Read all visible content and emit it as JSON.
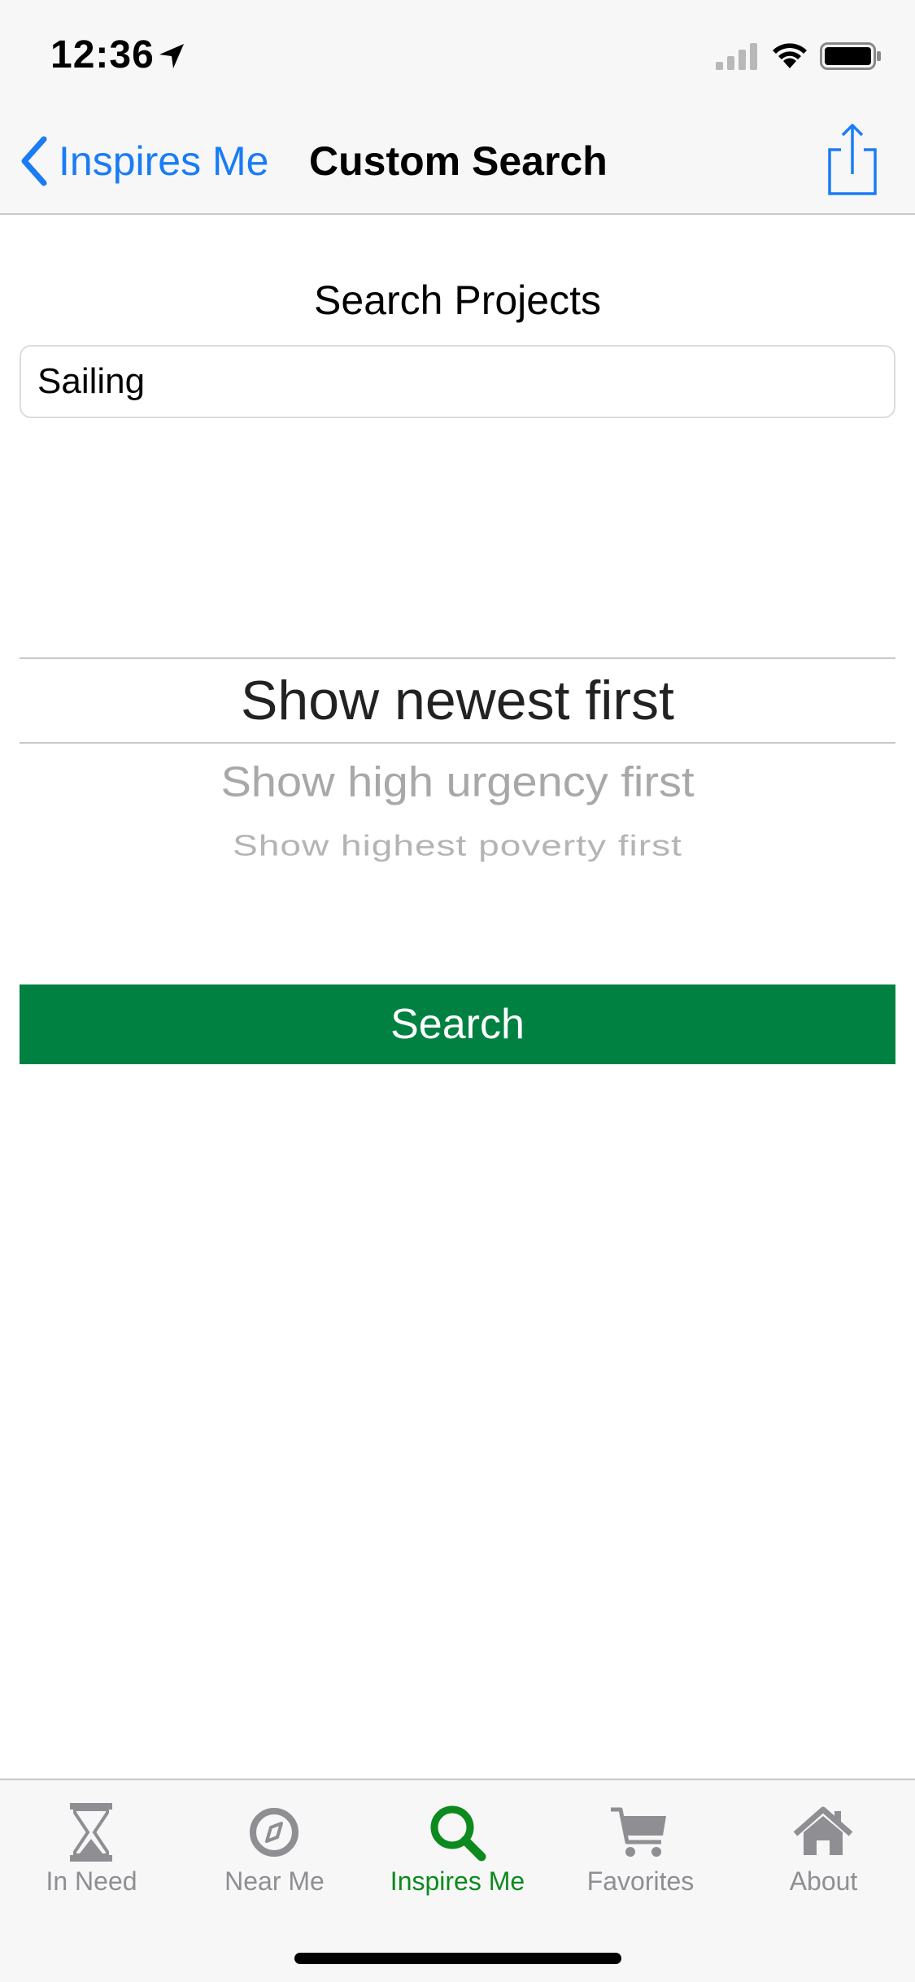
{
  "status": {
    "time": "12:36"
  },
  "nav": {
    "back_label": "Inspires Me",
    "title": "Custom Search"
  },
  "search": {
    "heading": "Search Projects",
    "input_value": "Sailing",
    "button_label": "Search"
  },
  "sort_picker": {
    "selected": "Show newest first",
    "options": [
      "Show newest first",
      "Show high urgency first",
      "Show highest poverty first"
    ]
  },
  "tabs": [
    {
      "label": "In Need",
      "icon": "hourglass-icon",
      "active": false
    },
    {
      "label": "Near Me",
      "icon": "compass-icon",
      "active": false
    },
    {
      "label": "Inspires Me",
      "icon": "search-icon",
      "active": true
    },
    {
      "label": "Favorites",
      "icon": "cart-icon",
      "active": false
    },
    {
      "label": "About",
      "icon": "home-icon",
      "active": false
    }
  ],
  "colors": {
    "accent_blue": "#1a7cf5",
    "search_button_green": "#008142",
    "active_tab_green": "#0c8a1e",
    "inactive_tab_gray": "#8e8e93"
  }
}
